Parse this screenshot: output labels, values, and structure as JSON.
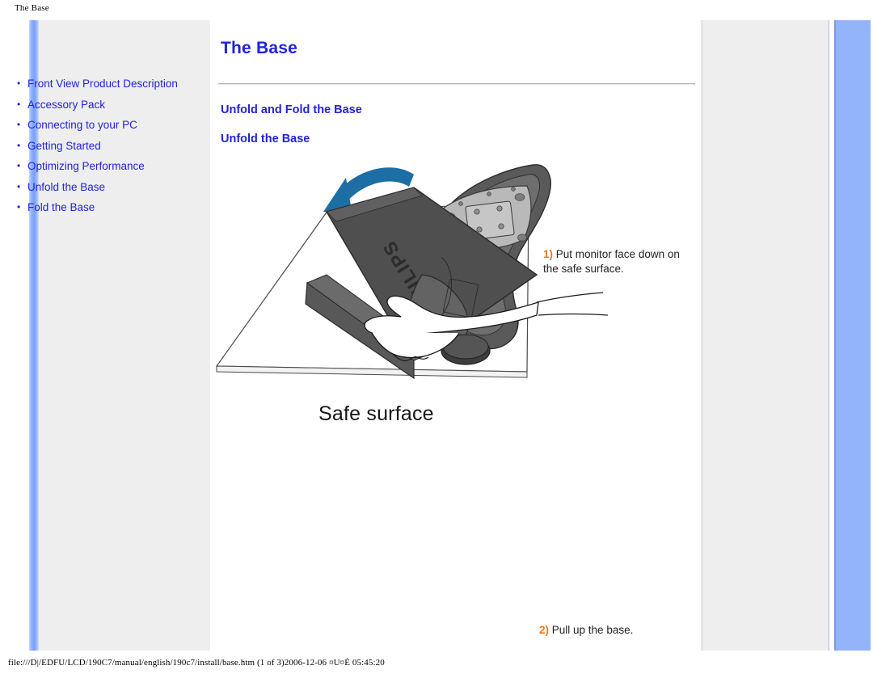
{
  "browser": {
    "header_title": "The Base",
    "footer_path": "file:///D|/EDFU/LCD/190C7/manual/english/190c7/install/base.htm (1 of 3)2006-12-06 ¤U¤È 05:45:20"
  },
  "sidebar": {
    "items": [
      {
        "label": "Front View Product Description"
      },
      {
        "label": "Accessory Pack"
      },
      {
        "label": "Connecting to your PC"
      },
      {
        "label": "Getting Started"
      },
      {
        "label": "Optimizing Performance"
      },
      {
        "label": "Unfold the Base"
      },
      {
        "label": "Fold the Base"
      }
    ]
  },
  "main": {
    "page_title": "The Base",
    "section_title": "Unfold and Fold the Base",
    "sub_title": "Unfold the Base",
    "figure": {
      "brand_label": "PHILIPS",
      "surface_label": "Safe surface"
    },
    "steps": [
      {
        "number": "1)",
        "text": " Put monitor face down on the safe surface."
      },
      {
        "number": "2)",
        "text": " Pull up the base."
      }
    ]
  },
  "colors": {
    "link_blue": "#2222dd",
    "accent_blue": "#93b3fb",
    "step_orange": "#e8761a",
    "arrow_blue": "#1c6ea4",
    "panel_gray": "#eeeeee"
  }
}
